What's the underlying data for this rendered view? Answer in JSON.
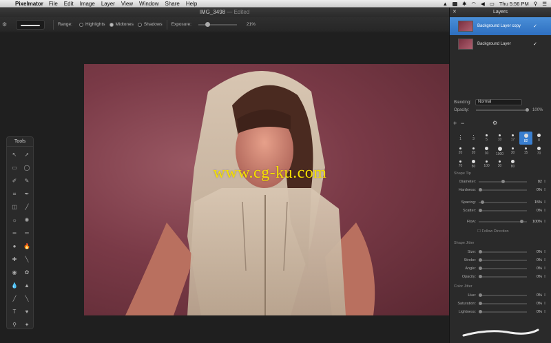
{
  "menubar": {
    "apple": "",
    "app_name": "Pixelmator",
    "items": [
      "File",
      "Edit",
      "Image",
      "Layer",
      "View",
      "Window",
      "Share",
      "Help"
    ],
    "clock": "Thu 5:56 PM"
  },
  "window": {
    "title": "IMG_3498",
    "edited": "— Edited"
  },
  "toolbar": {
    "range_label": "Range:",
    "options": [
      "Highlights",
      "Midtones",
      "Shadows"
    ],
    "selected_option": "Midtones",
    "exposure_label": "Exposure:",
    "exposure_value": "21%",
    "exposure_fraction": 0.21
  },
  "watermark": "www.cg-ku.com",
  "tools": {
    "title": "Tools",
    "icons": [
      "move-icon",
      "arrow-icon",
      "rect-select-icon",
      "ellipse-select-icon",
      "lasso-icon",
      "poly-lasso-icon",
      "crop-icon",
      "eyedropper-icon",
      "eraser-icon",
      "pencil-icon",
      "smudge-icon",
      "sponge-icon",
      "dodge-icon",
      "burn-icon",
      "pen-icon",
      "flame-icon",
      "clone-icon",
      "brush-icon",
      "redeye-icon",
      "heal-icon",
      "drop-icon",
      "sharpen-icon",
      "line-icon",
      "blur-icon",
      "text-icon",
      "color-icon",
      "zoom-icon",
      "hand-icon"
    ],
    "glyphs": [
      "↖",
      "➚",
      "▭",
      "◯",
      "✐",
      "✎",
      "⌗",
      "✒",
      "◫",
      "╱",
      "☼",
      "✺",
      "━",
      "═",
      "●",
      "🔥",
      "✚",
      "╲",
      "◉",
      "✿",
      "💧",
      "▲",
      "╱",
      "╲",
      "T",
      "♥",
      "⚲",
      "✦"
    ]
  },
  "layers_panel": {
    "title": "Layers",
    "layers": [
      {
        "name": "Background Layer copy",
        "selected": true
      },
      {
        "name": "Background Layer",
        "selected": false
      }
    ],
    "blending_label": "Blending:",
    "blending_value": "Normal",
    "opacity_label": "Opacity:",
    "opacity_value": "100%"
  },
  "brushes": [
    {
      "size": "1",
      "dot": 1
    },
    {
      "size": "3",
      "dot": 1.5
    },
    {
      "size": "5",
      "dot": 2
    },
    {
      "size": "10",
      "dot": 2.5
    },
    {
      "size": "17",
      "dot": 3
    },
    {
      "size": "82",
      "dot": 5,
      "selected": true
    },
    {
      "size": "8",
      "dot": 4
    },
    {
      "size": "20",
      "dot": 3
    },
    {
      "size": "20",
      "dot": 3
    },
    {
      "size": "30",
      "dot": 4
    },
    {
      "size": "1000",
      "dot": 5
    },
    {
      "size": "30",
      "dot": 3
    },
    {
      "size": "15",
      "dot": 3
    },
    {
      "size": "70",
      "dot": 4
    },
    {
      "size": "70",
      "dot": 3
    },
    {
      "size": "80",
      "dot": 4
    },
    {
      "size": "100",
      "dot": 3
    },
    {
      "size": "30",
      "dot": 3
    },
    {
      "size": "80",
      "dot": 4
    }
  ],
  "shape_tip": {
    "title": "Shape Tip",
    "rows": [
      {
        "name": "Diameter:",
        "value": "82",
        "pos": 0.55
      },
      {
        "name": "Hardness:",
        "value": "0%",
        "pos": 0.0
      },
      {
        "name": "Spacing:",
        "value": "15%",
        "pos": 0.05
      },
      {
        "name": "Scatter:",
        "value": "0%",
        "pos": 0.0
      },
      {
        "name": "Flow:",
        "value": "100%",
        "pos": 1.0
      }
    ],
    "follow_direction": "Follow Direction"
  },
  "shape_jitter": {
    "title": "Shape Jitter",
    "rows": [
      {
        "name": "Size:",
        "value": "0%"
      },
      {
        "name": "Stroke:",
        "value": "0%"
      },
      {
        "name": "Angle:",
        "value": "0%"
      },
      {
        "name": "Opacity:",
        "value": "0%"
      }
    ]
  },
  "color_jitter": {
    "title": "Color Jitter",
    "rows": [
      {
        "name": "Hue:",
        "value": "0%"
      },
      {
        "name": "Saturation:",
        "value": "0%"
      },
      {
        "name": "Lightness:",
        "value": "0%"
      }
    ]
  }
}
